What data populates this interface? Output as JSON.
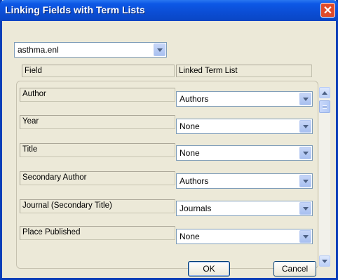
{
  "window": {
    "title": "Linking Fields with Term Lists"
  },
  "library_select": {
    "value": "asthma.enl"
  },
  "headers": {
    "field": "Field",
    "linked": "Linked Term List"
  },
  "rows": [
    {
      "field": "Author",
      "term_list": "Authors"
    },
    {
      "field": "Year",
      "term_list": "None"
    },
    {
      "field": "Title",
      "term_list": "None"
    },
    {
      "field": "Secondary Author",
      "term_list": "Authors"
    },
    {
      "field": "Journal (Secondary Title)",
      "term_list": "Journals"
    },
    {
      "field": "Place Published",
      "term_list": "None"
    }
  ],
  "buttons": {
    "ok": "OK",
    "cancel": "Cancel"
  },
  "icons": {
    "close": "close-icon",
    "dropdown": "chevron-down-icon",
    "scroll_up": "chevron-up-icon",
    "scroll_down": "chevron-down-icon"
  },
  "colors": {
    "title_bar": "#0b4ed6",
    "close_button": "#e04b2a",
    "dialog_bg": "#ece9d8"
  }
}
